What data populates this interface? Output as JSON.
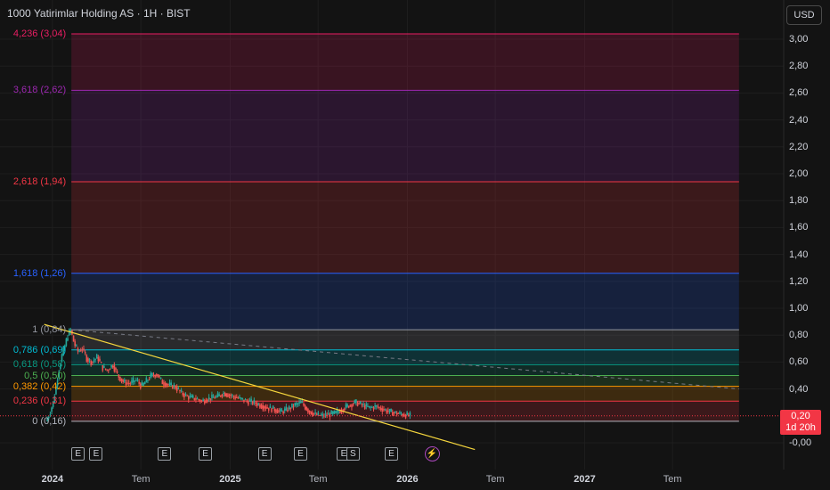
{
  "header": {
    "title": "1000 Yatirimlar Holding AS · 1H · BIST",
    "currency": "USD"
  },
  "price_badge": {
    "price": "0,20",
    "countdown": "1d 20h"
  },
  "colors": {
    "background": "#131313",
    "up": "#26a69a",
    "down": "#ef5350",
    "trendline": "#f5d63d"
  },
  "chart_data": {
    "type": "candlestick",
    "title": "1000 Yatirimlar Holding AS · 1H · BIST",
    "currency": "USD",
    "x_axis": {
      "type": "date",
      "range": [
        "2023-09-15",
        "2028-02-15"
      ],
      "ticks": [
        {
          "date": "2024-01-01",
          "label": "2024",
          "major": true
        },
        {
          "date": "2024-07-01",
          "label": "Tem",
          "major": false
        },
        {
          "date": "2025-01-01",
          "label": "2025",
          "major": true
        },
        {
          "date": "2025-07-01",
          "label": "Tem",
          "major": false
        },
        {
          "date": "2026-01-01",
          "label": "2026",
          "major": true
        },
        {
          "date": "2026-07-01",
          "label": "Tem",
          "major": false
        },
        {
          "date": "2027-01-01",
          "label": "2027",
          "major": true
        },
        {
          "date": "2027-07-01",
          "label": "Tem",
          "major": false
        }
      ]
    },
    "y_axis": {
      "range": [
        -0.05,
        3.05
      ],
      "ticks": [
        "3,00",
        "2,80",
        "2,60",
        "2,40",
        "2,20",
        "2,00",
        "1,80",
        "1,60",
        "1,40",
        "1,20",
        "1,00",
        "0,80",
        "0,60",
        "0,40",
        "-0,00"
      ],
      "tick_values": [
        3.0,
        2.8,
        2.6,
        2.4,
        2.2,
        2.0,
        1.8,
        1.6,
        1.4,
        1.2,
        1.0,
        0.8,
        0.6,
        0.4,
        0.0
      ]
    },
    "last_price": 0.2,
    "price_path": [
      [
        "2023-12-20",
        0.16
      ],
      [
        "2023-12-28",
        0.22
      ],
      [
        "2024-01-04",
        0.3
      ],
      [
        "2024-01-10",
        0.42
      ],
      [
        "2024-01-16",
        0.55
      ],
      [
        "2024-01-22",
        0.65
      ],
      [
        "2024-01-28",
        0.72
      ],
      [
        "2024-02-03",
        0.8
      ],
      [
        "2024-02-09",
        0.84
      ],
      [
        "2024-02-16",
        0.74
      ],
      [
        "2024-02-24",
        0.68
      ],
      [
        "2024-03-04",
        0.7
      ],
      [
        "2024-03-14",
        0.62
      ],
      [
        "2024-03-24",
        0.6
      ],
      [
        "2024-04-04",
        0.64
      ],
      [
        "2024-04-14",
        0.56
      ],
      [
        "2024-04-24",
        0.54
      ],
      [
        "2024-05-06",
        0.58
      ],
      [
        "2024-05-16",
        0.5
      ],
      [
        "2024-05-28",
        0.45
      ],
      [
        "2024-06-10",
        0.44
      ],
      [
        "2024-06-22",
        0.47
      ],
      [
        "2024-07-04",
        0.42
      ],
      [
        "2024-07-14",
        0.46
      ],
      [
        "2024-07-24",
        0.5
      ],
      [
        "2024-08-04",
        0.51
      ],
      [
        "2024-08-16",
        0.45
      ],
      [
        "2024-08-28",
        0.43
      ],
      [
        "2024-09-10",
        0.42
      ],
      [
        "2024-09-24",
        0.37
      ],
      [
        "2024-10-08",
        0.34
      ],
      [
        "2024-10-22",
        0.33
      ],
      [
        "2024-11-05",
        0.31
      ],
      [
        "2024-11-20",
        0.33
      ],
      [
        "2024-12-05",
        0.34
      ],
      [
        "2024-12-20",
        0.37
      ],
      [
        "2025-01-05",
        0.35
      ],
      [
        "2025-01-20",
        0.33
      ],
      [
        "2025-02-05",
        0.31
      ],
      [
        "2025-02-20",
        0.3
      ],
      [
        "2025-03-06",
        0.28
      ],
      [
        "2025-03-20",
        0.26
      ],
      [
        "2025-04-03",
        0.25
      ],
      [
        "2025-04-17",
        0.23
      ],
      [
        "2025-05-01",
        0.25
      ],
      [
        "2025-05-15",
        0.28
      ],
      [
        "2025-05-29",
        0.3
      ],
      [
        "2025-06-12",
        0.24
      ],
      [
        "2025-06-26",
        0.21
      ],
      [
        "2025-07-10",
        0.2
      ],
      [
        "2025-07-24",
        0.21
      ],
      [
        "2025-08-07",
        0.22
      ],
      [
        "2025-08-21",
        0.25
      ],
      [
        "2025-09-04",
        0.28
      ],
      [
        "2025-09-18",
        0.3
      ],
      [
        "2025-10-02",
        0.28
      ],
      [
        "2025-10-16",
        0.26
      ],
      [
        "2025-10-30",
        0.27
      ],
      [
        "2025-11-13",
        0.25
      ],
      [
        "2025-11-27",
        0.23
      ],
      [
        "2025-12-11",
        0.22
      ],
      [
        "2025-12-25",
        0.21
      ],
      [
        "2026-01-08",
        0.2
      ]
    ],
    "fibonacci": {
      "anchors": {
        "from_date": "2024-02-09",
        "to_date": "2027-11-15"
      },
      "levels": [
        {
          "ratio": 0,
          "price": 0.16,
          "label": "0 (0,16)",
          "color": "#b2b5be"
        },
        {
          "ratio": 0.236,
          "price": 0.31,
          "label": "0,236 (0,31)",
          "color": "#f23645"
        },
        {
          "ratio": 0.382,
          "price": 0.42,
          "label": "0,382 (0,42)",
          "color": "#ff9800"
        },
        {
          "ratio": 0.5,
          "price": 0.5,
          "label": "0,5 (0,50)",
          "color": "#4caf50"
        },
        {
          "ratio": 0.618,
          "price": 0.58,
          "label": "0,618 (0,58)",
          "color": "#089981"
        },
        {
          "ratio": 0.786,
          "price": 0.69,
          "label": "0,786 (0,69)",
          "color": "#00bcd4"
        },
        {
          "ratio": 1,
          "price": 0.84,
          "label": "1 (0,84)",
          "color": "#9598a1"
        },
        {
          "ratio": 1.618,
          "price": 1.26,
          "label": "1,618 (1,26)",
          "color": "#2962ff"
        },
        {
          "ratio": 2.618,
          "price": 1.94,
          "label": "2,618 (1,94)",
          "color": "#f23645"
        },
        {
          "ratio": 3.618,
          "price": 2.62,
          "label": "3,618 (2,62)",
          "color": "#9c27b0"
        },
        {
          "ratio": 4.236,
          "price": 3.04,
          "label": "4,236 (3,04)",
          "color": "#e91e63"
        }
      ]
    },
    "trendlines": [
      {
        "from": [
          "2023-12-15",
          0.88
        ],
        "to": [
          "2026-05-20",
          -0.05
        ],
        "style": "solid",
        "color": "#f5d63d"
      },
      {
        "from": [
          "2024-02-09",
          0.84
        ],
        "to": [
          "2027-11-15",
          0.4
        ],
        "style": "dashed",
        "color": "#787b86"
      }
    ],
    "events": [
      {
        "date": "2024-02-22",
        "label": "E"
      },
      {
        "date": "2024-03-30",
        "label": "E"
      },
      {
        "date": "2024-08-18",
        "label": "E"
      },
      {
        "date": "2024-11-10",
        "label": "E"
      },
      {
        "date": "2025-03-12",
        "label": "E"
      },
      {
        "date": "2025-05-25",
        "label": "E"
      },
      {
        "date": "2025-08-22",
        "label": "E"
      },
      {
        "date": "2025-09-10",
        "label": "S"
      },
      {
        "date": "2025-11-28",
        "label": "E"
      },
      {
        "date": "2026-02-18",
        "label": "⚡",
        "kind": "split"
      }
    ]
  }
}
